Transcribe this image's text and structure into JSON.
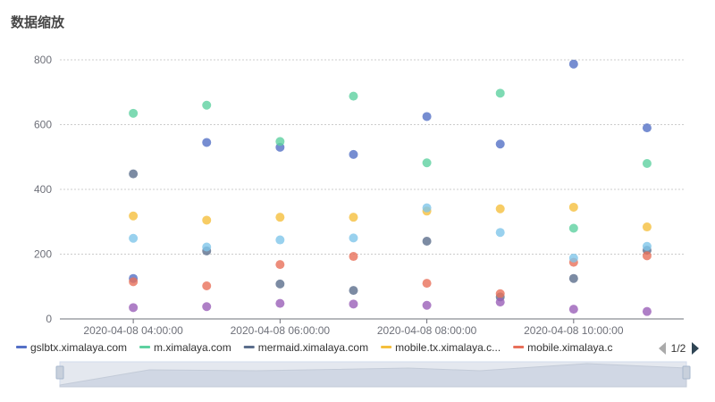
{
  "title": "数据缩放",
  "chart_data": {
    "type": "scatter",
    "title": "数据缩放",
    "xlabel": "",
    "ylabel": "",
    "ylim": [
      0,
      800
    ],
    "yticks": [
      "0",
      "200",
      "400",
      "600",
      "800"
    ],
    "xticks": [
      {
        "label": "2020-04-08 04:00:00",
        "x": "2020-04-08 04:00:00"
      },
      {
        "label": "2020-04-08 06:00:00",
        "x": "2020-04-08 06:00:00"
      },
      {
        "label": "2020-04-08 08:00:00",
        "x": "2020-04-08 08:00:00"
      },
      {
        "label": "2020-04-08 10:00:00",
        "x": "2020-04-08 10:00:00"
      }
    ],
    "x": [
      "2020-04-08 04:00:00",
      "2020-04-08 05:00:00",
      "2020-04-08 06:00:00",
      "2020-04-08 07:00:00",
      "2020-04-08 08:00:00",
      "2020-04-08 09:00:00",
      "2020-04-08 10:00:00",
      "2020-04-08 11:00:00"
    ],
    "xlim": [
      "2020-04-08 03:00:00",
      "2020-04-08 11:30:00"
    ],
    "grid": true,
    "legend_position": "bottom",
    "series": [
      {
        "name": "gslbtx.ximalaya.com",
        "legend_label": "gslbtx.ximalaya.com",
        "color": "#5470c6",
        "values": [
          125,
          545,
          530,
          508,
          625,
          540,
          787,
          590
        ]
      },
      {
        "name": "m.ximalaya.com",
        "legend_label": "m.ximalaya.com",
        "color": "#5ed1a0",
        "values": [
          635,
          660,
          548,
          688,
          482,
          697,
          280,
          480
        ]
      },
      {
        "name": "mermaid.ximalaya.com",
        "legend_label": "mermaid.ximalaya.com",
        "color": "#5b6e8c",
        "values": [
          448,
          210,
          108,
          88,
          240,
          68,
          125,
          212
        ]
      },
      {
        "name": "mobile.tx.ximalaya.c...",
        "legend_label": "mobile.tx.ximalaya.c...",
        "color": "#f5bf3d",
        "values": [
          318,
          305,
          314,
          314,
          333,
          340,
          345,
          284
        ]
      },
      {
        "name": "mobile.ximalaya.c",
        "legend_label": "mobile.ximalaya.c",
        "color": "#e8705a",
        "values": [
          115,
          102,
          168,
          193,
          110,
          78,
          175,
          195
        ]
      },
      {
        "name": "",
        "color": "#7fc6ea",
        "values": [
          249,
          222,
          244,
          250,
          343,
          267,
          188,
          224
        ]
      },
      {
        "name": "",
        "color": "#9a5fb8",
        "values": [
          35,
          38,
          48,
          46,
          42,
          52,
          30,
          23
        ]
      }
    ],
    "pager": {
      "text": "1/2"
    },
    "datazoom": {
      "start": 0,
      "end": 100
    }
  }
}
